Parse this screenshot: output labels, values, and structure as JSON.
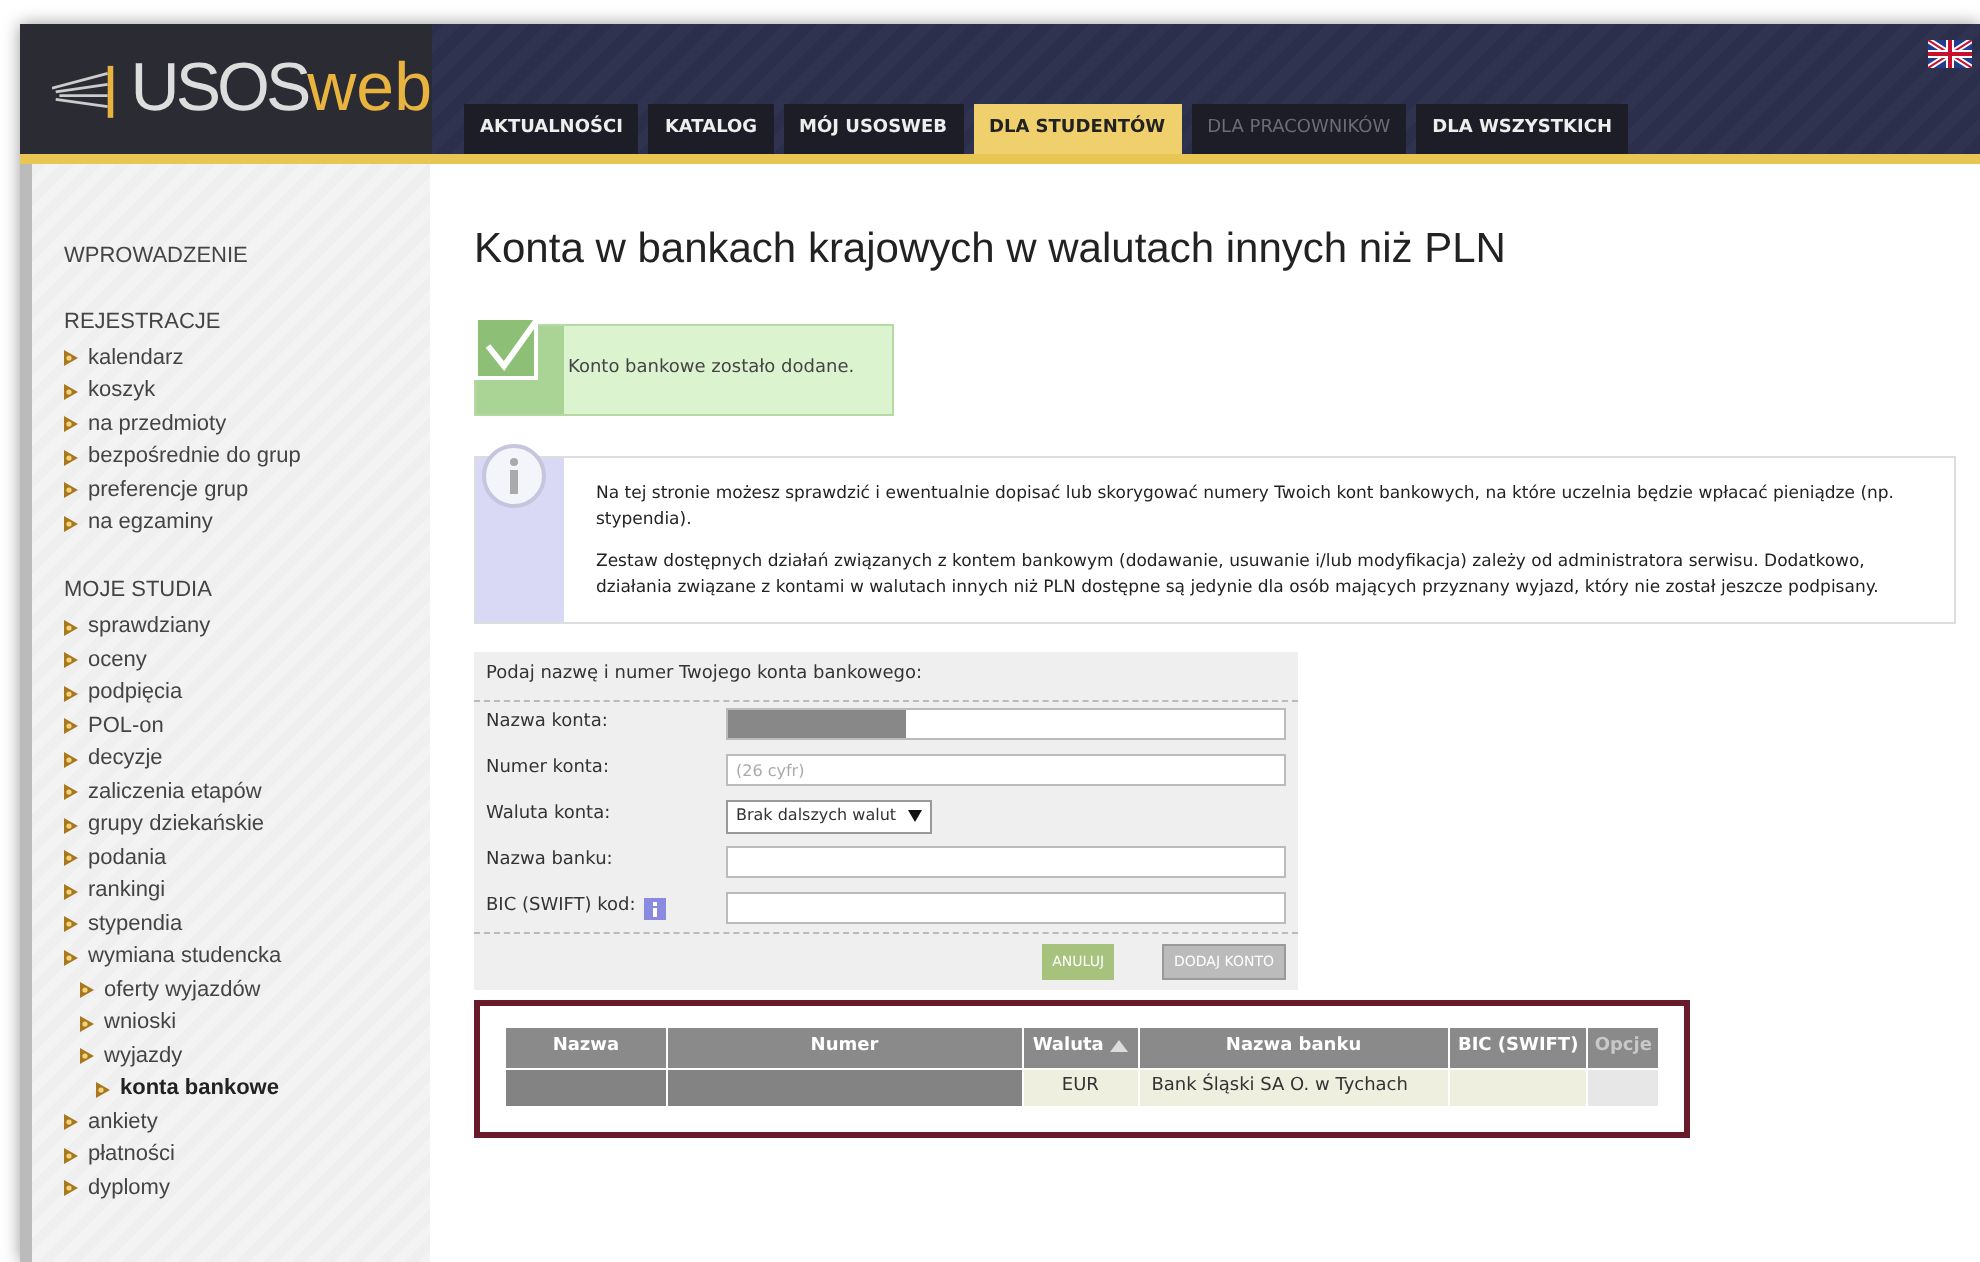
{
  "header": {
    "logo_left": "USOS",
    "logo_right": "web"
  },
  "tabs": [
    {
      "label": "AKTUALNOŚCI",
      "selected": false,
      "disabled": false
    },
    {
      "label": "KATALOG",
      "selected": false,
      "disabled": false
    },
    {
      "label": "MÓJ USOSWEB",
      "selected": false,
      "disabled": false
    },
    {
      "label": "DLA STUDENTÓW",
      "selected": true,
      "disabled": false
    },
    {
      "label": "DLA PRACOWNIKÓW",
      "selected": false,
      "disabled": true
    },
    {
      "label": "DLA WSZYSTKICH",
      "selected": false,
      "disabled": false
    }
  ],
  "sidebar": {
    "sections": [
      {
        "title": "WPROWADZENIE"
      },
      {
        "title": "REJESTRACJE",
        "items": [
          {
            "label": "kalendarz",
            "selected": false
          },
          {
            "label": "koszyk",
            "selected": false
          },
          {
            "label": "na przedmioty",
            "selected": false
          },
          {
            "label": "bezpośrednie do grup",
            "selected": false
          },
          {
            "label": "preferencje grup",
            "selected": false
          },
          {
            "label": "na egzaminy",
            "selected": false
          }
        ]
      },
      {
        "title": "MOJE STUDIA",
        "items": [
          {
            "label": "sprawdziany",
            "selected": false
          },
          {
            "label": "oceny",
            "selected": false
          },
          {
            "label": "podpięcia",
            "selected": false
          },
          {
            "label": "POL-on",
            "selected": false
          },
          {
            "label": "decyzje",
            "selected": false
          },
          {
            "label": "zaliczenia etapów",
            "selected": false
          },
          {
            "label": "grupy dziekańskie",
            "selected": false
          },
          {
            "label": "podania",
            "selected": false
          },
          {
            "label": "rankingi",
            "selected": false
          },
          {
            "label": "stypendia",
            "selected": false
          },
          {
            "label": "wymiana studencka",
            "selected": false,
            "children": [
              {
                "label": "oferty wyjazdów",
                "selected": false
              },
              {
                "label": "wnioski",
                "selected": false
              },
              {
                "label": "wyjazdy",
                "selected": false,
                "children": [
                  {
                    "label": "konta bankowe",
                    "selected": true
                  }
                ]
              }
            ]
          },
          {
            "label": "ankiety",
            "selected": false
          },
          {
            "label": "płatności",
            "selected": false
          },
          {
            "label": "dyplomy",
            "selected": false
          }
        ]
      }
    ]
  },
  "page_title": "Konta w bankach krajowych w walutach innych niż PLN",
  "success_message": "Konto bankowe zostało dodane.",
  "info_paragraphs": [
    "Na tej stronie możesz sprawdzić i ewentualnie dopisać lub skorygować numery Twoich kont bankowych, na które uczelnia będzie wpłacać pieniądze (np. stypendia).",
    "Zestaw dostępnych działań związanych z kontem bankowym (dodawanie, usuwanie i/lub modyfikacja) zależy od administratora serwisu. Dodatkowo, działania związane z kontami w walutach innych niż PLN dostępne są jedynie dla osób mających przyznany wyjazd, który nie został jeszcze podpisany."
  ],
  "form": {
    "heading": "Podaj nazwę i numer Twojego konta bankowego:",
    "fields": [
      {
        "label": "Nazwa konta:",
        "kind": "redacted"
      },
      {
        "label": "Numer konta:",
        "kind": "text",
        "placeholder": "(26 cyfr)"
      },
      {
        "label": "Waluta konta:",
        "kind": "select",
        "value": "Brak dalszych walut"
      },
      {
        "label": "Nazwa banku:",
        "kind": "text"
      },
      {
        "label": "BIC (SWIFT) kod:",
        "kind": "text",
        "info": true
      }
    ],
    "buttons": [
      "ANULUJ",
      "DODAJ KONTO"
    ]
  },
  "table": {
    "columns": [
      {
        "label": "Nazwa",
        "sorted": false,
        "disabled": false
      },
      {
        "label": "Numer",
        "sorted": false,
        "disabled": false
      },
      {
        "label": "Waluta",
        "sorted": true,
        "disabled": false
      },
      {
        "label": "Nazwa banku",
        "sorted": false,
        "disabled": false
      },
      {
        "label": "BIC (SWIFT)",
        "sorted": false,
        "disabled": false
      },
      {
        "label": "Opcje",
        "sorted": false,
        "disabled": true
      }
    ],
    "rows": [
      [
        {
          "kind": "redacted"
        },
        {
          "kind": "redacted"
        },
        {
          "kind": "text",
          "text": "EUR"
        },
        {
          "kind": "text",
          "text": "Bank Śląski SA O. w Tychach"
        },
        {
          "kind": "blank"
        },
        {
          "kind": "empty"
        }
      ]
    ]
  }
}
